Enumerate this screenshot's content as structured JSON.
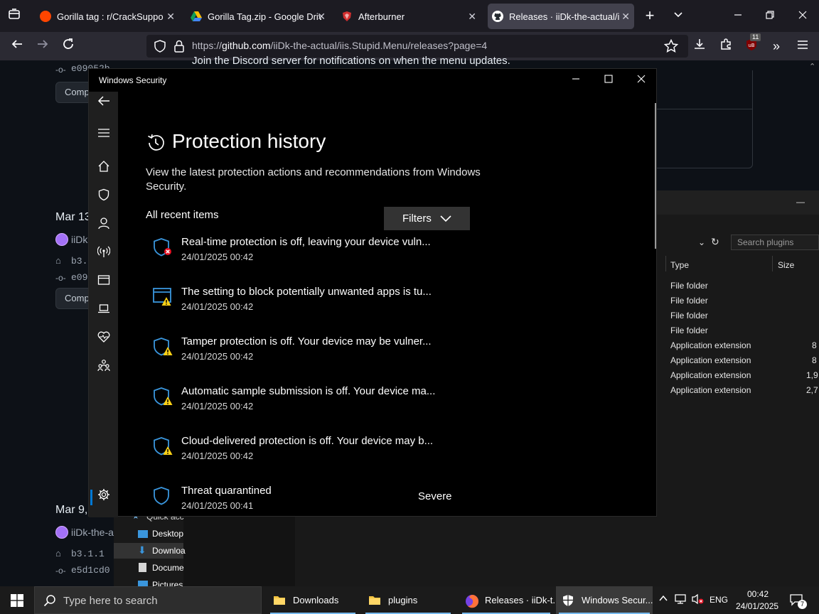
{
  "browser": {
    "tabs": [
      {
        "label": "Gorilla tag : r/CrackSupport",
        "icon": "reddit-icon"
      },
      {
        "label": "Gorilla Tag.zip - Google Drive",
        "icon": "google-drive-icon"
      },
      {
        "label": "Afterburner",
        "icon": "afterburner-icon"
      },
      {
        "label": "Releases · iiDk-the-actual/iis.",
        "icon": "github-icon"
      }
    ],
    "url_scheme": "https://",
    "url_host": "github.com",
    "url_path": "/iiDk-the-actual/iis.Stupid.Menu/releases?page=4",
    "extension_badge": "11"
  },
  "github": {
    "discord_note": "Join the Discord server for notifications on when the menu updates.",
    "commit_hash_top": "e09052b",
    "compare_label": "Comp",
    "release2_date": "Mar 13",
    "release2_author": "iiDk",
    "release2_tag": "b3.",
    "release2_commit": "e09",
    "release3_date": "Mar 9,",
    "release3_author": "iiDk-the-a",
    "release3_tag": "b3.1.1",
    "release3_commit": "e5d1cd0"
  },
  "explorer": {
    "search_placeholder": "Search plugins",
    "col_type": "Type",
    "col_size": "Size",
    "rows": [
      {
        "type": "File folder",
        "size": ""
      },
      {
        "type": "File folder",
        "size": ""
      },
      {
        "type": "File folder",
        "size": ""
      },
      {
        "type": "File folder",
        "size": ""
      },
      {
        "type": "Application extension",
        "size": "8"
      },
      {
        "type": "Application extension",
        "size": "8"
      },
      {
        "type": "Application extension",
        "size": "1,9"
      },
      {
        "type": "Application extension",
        "size": "2,7"
      }
    ],
    "nav_quick": "Quick acc",
    "nav_items": [
      "Desktop",
      "Downloa",
      "Docume",
      "Pictures"
    ]
  },
  "security": {
    "window_title": "Windows Security",
    "page_title": "Protection history",
    "description": "View the latest protection actions and recommendations from Windows Security.",
    "filter_label": "All recent items",
    "filters_button": "Filters",
    "items": [
      {
        "title": "Real-time protection is off, leaving your device vuln...",
        "date": "24/01/2025 00:42",
        "severity": "",
        "icon": "shield-error-icon"
      },
      {
        "title": "The setting to block potentially unwanted apps is tu...",
        "date": "24/01/2025 00:42",
        "severity": "",
        "icon": "app-browser-warning-icon"
      },
      {
        "title": "Tamper protection is off. Your device may be vulner...",
        "date": "24/01/2025 00:42",
        "severity": "",
        "icon": "shield-warning-icon"
      },
      {
        "title": "Automatic sample submission is off. Your device ma...",
        "date": "24/01/2025 00:42",
        "severity": "",
        "icon": "shield-warning-icon"
      },
      {
        "title": "Cloud-delivered protection is off. Your device may b...",
        "date": "24/01/2025 00:42",
        "severity": "",
        "icon": "shield-warning-icon"
      },
      {
        "title": "Threat quarantined",
        "date": "24/01/2025 00:41",
        "severity": "Severe",
        "icon": "shield-icon"
      }
    ]
  },
  "taskbar": {
    "search_placeholder": "Type here to search",
    "apps": [
      {
        "label": "Downloads",
        "icon": "folder-icon"
      },
      {
        "label": "plugins",
        "icon": "folder-icon"
      },
      {
        "label": "Releases · iiDk-t...",
        "icon": "firefox-icon"
      },
      {
        "label": "Windows Secur...",
        "icon": "windows-security-icon"
      }
    ],
    "language": "ENG",
    "time": "00:42",
    "date": "24/01/2025",
    "notification_count": "7"
  },
  "colors": {
    "accent": "#0078d4",
    "warning": "#fcd116",
    "error": "#e81123",
    "shield_blue": "#3a96dd"
  }
}
